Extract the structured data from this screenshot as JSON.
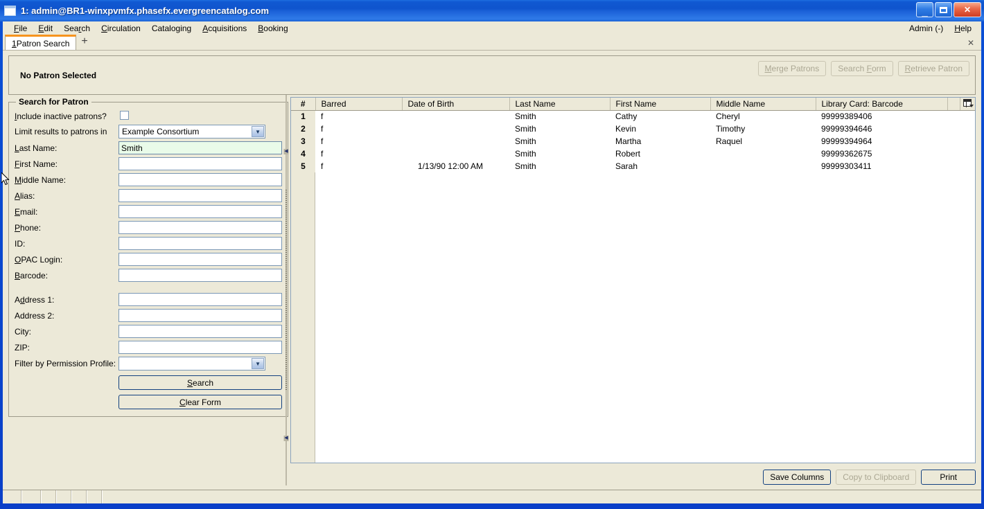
{
  "window": {
    "title": "1: admin@BR1-winxpvmfx.phasefx.evergreencatalog.com",
    "icon": "window-icon",
    "minimize": "_",
    "maximize": "maximize-icon",
    "close": "✕"
  },
  "menubar": {
    "items": [
      {
        "label": "File",
        "accesskey": "F"
      },
      {
        "label": "Edit",
        "accesskey": "E"
      },
      {
        "label": "Search",
        "accesskey": "r"
      },
      {
        "label": "Circulation",
        "accesskey": "C"
      },
      {
        "label": "Cataloging",
        "accesskey": "g"
      },
      {
        "label": "Acquisitions",
        "accesskey": "A"
      },
      {
        "label": "Booking",
        "accesskey": "B"
      }
    ],
    "right": [
      {
        "label": "Admin (-)",
        "accesskey": ""
      },
      {
        "label": "Help",
        "accesskey": "H"
      }
    ]
  },
  "tabs": {
    "items": [
      {
        "number": "1",
        "label": "Patron Search"
      }
    ],
    "add_label": "+",
    "close_label": "✕"
  },
  "patron_header": {
    "title": "No Patron Selected",
    "buttons": [
      {
        "label": "Merge Patrons",
        "accesskey": "M",
        "enabled": false
      },
      {
        "label": "Search Form",
        "accesskey": "F",
        "enabled": false
      },
      {
        "label": "Retrieve Patron",
        "accesskey": "R",
        "enabled": false
      }
    ]
  },
  "search_form": {
    "legend": "Search for Patron",
    "fields": [
      {
        "label": "Include inactive patrons?",
        "accesskey": "I",
        "type": "checkbox",
        "value": "",
        "checked": false
      },
      {
        "label": "Limit results to patrons in",
        "accesskey": "",
        "type": "select",
        "value": "Example Consortium"
      },
      {
        "label": "Last Name:",
        "accesskey": "L",
        "type": "text",
        "value": "Smith",
        "focused": true
      },
      {
        "label": "First Name:",
        "accesskey": "F",
        "type": "text",
        "value": ""
      },
      {
        "label": "Middle Name:",
        "accesskey": "M",
        "type": "text",
        "value": ""
      },
      {
        "label": "Alias:",
        "accesskey": "A",
        "type": "text",
        "value": ""
      },
      {
        "label": "Email:",
        "accesskey": "E",
        "type": "text",
        "value": ""
      },
      {
        "label": "Phone:",
        "accesskey": "P",
        "type": "text",
        "value": ""
      },
      {
        "label": "ID:",
        "accesskey": "I",
        "type": "text",
        "value": ""
      },
      {
        "label": "OPAC Login:",
        "accesskey": "O",
        "type": "text",
        "value": ""
      },
      {
        "label": "Barcode:",
        "accesskey": "B",
        "type": "text",
        "value": ""
      },
      {
        "label": "Address 1:",
        "accesskey": "d",
        "type": "text",
        "value": "",
        "gap_before": true
      },
      {
        "label": "Address 2:",
        "accesskey": "",
        "type": "text",
        "value": ""
      },
      {
        "label": "City:",
        "accesskey": "",
        "type": "text",
        "value": ""
      },
      {
        "label": "ZIP:",
        "accesskey": "",
        "type": "text",
        "value": ""
      },
      {
        "label": "Filter by Permission Profile:",
        "accesskey": "",
        "type": "select",
        "value": ""
      }
    ],
    "search_button": {
      "label": "Search",
      "accesskey": "S"
    },
    "clear_button": {
      "label": "Clear Form",
      "accesskey": "C"
    }
  },
  "results": {
    "columns": [
      "#",
      "Barred",
      "Date of Birth",
      "Last Name",
      "First Name",
      "Middle Name",
      "Library Card: Barcode"
    ],
    "column_picker_icon": "column-picker-icon",
    "rows": [
      {
        "num": "1",
        "barred": "f",
        "dob": "",
        "last": "Smith",
        "first": "Cathy",
        "middle": "Cheryl",
        "barcode": "99999389406"
      },
      {
        "num": "2",
        "barred": "f",
        "dob": "",
        "last": "Smith",
        "first": "Kevin",
        "middle": "Timothy",
        "barcode": "99999394646"
      },
      {
        "num": "3",
        "barred": "f",
        "dob": "",
        "last": "Smith",
        "first": "Martha",
        "middle": "Raquel",
        "barcode": "99999394964"
      },
      {
        "num": "4",
        "barred": "f",
        "dob": "",
        "last": "Smith",
        "first": "Robert",
        "middle": "",
        "barcode": "99999362675"
      },
      {
        "num": "5",
        "barred": "f",
        "dob": "1/13/90 12:00 AM",
        "last": "Smith",
        "first": "Sarah",
        "middle": "",
        "barcode": "99999303411"
      }
    ],
    "footer_buttons": [
      {
        "label": "Save Columns",
        "enabled": true
      },
      {
        "label": "Copy to Clipboard",
        "enabled": false
      },
      {
        "label": "Print",
        "enabled": true
      }
    ]
  },
  "statusbar": {
    "cells": [
      "",
      "",
      "",
      "",
      "",
      "",
      ""
    ]
  },
  "colors": {
    "titlebar_blue": "#0f54cd",
    "face": "#ece9d8",
    "tab_accent": "#f7941e",
    "field_focus_green": "#e9fbe9",
    "field_border": "#7a97b5"
  }
}
